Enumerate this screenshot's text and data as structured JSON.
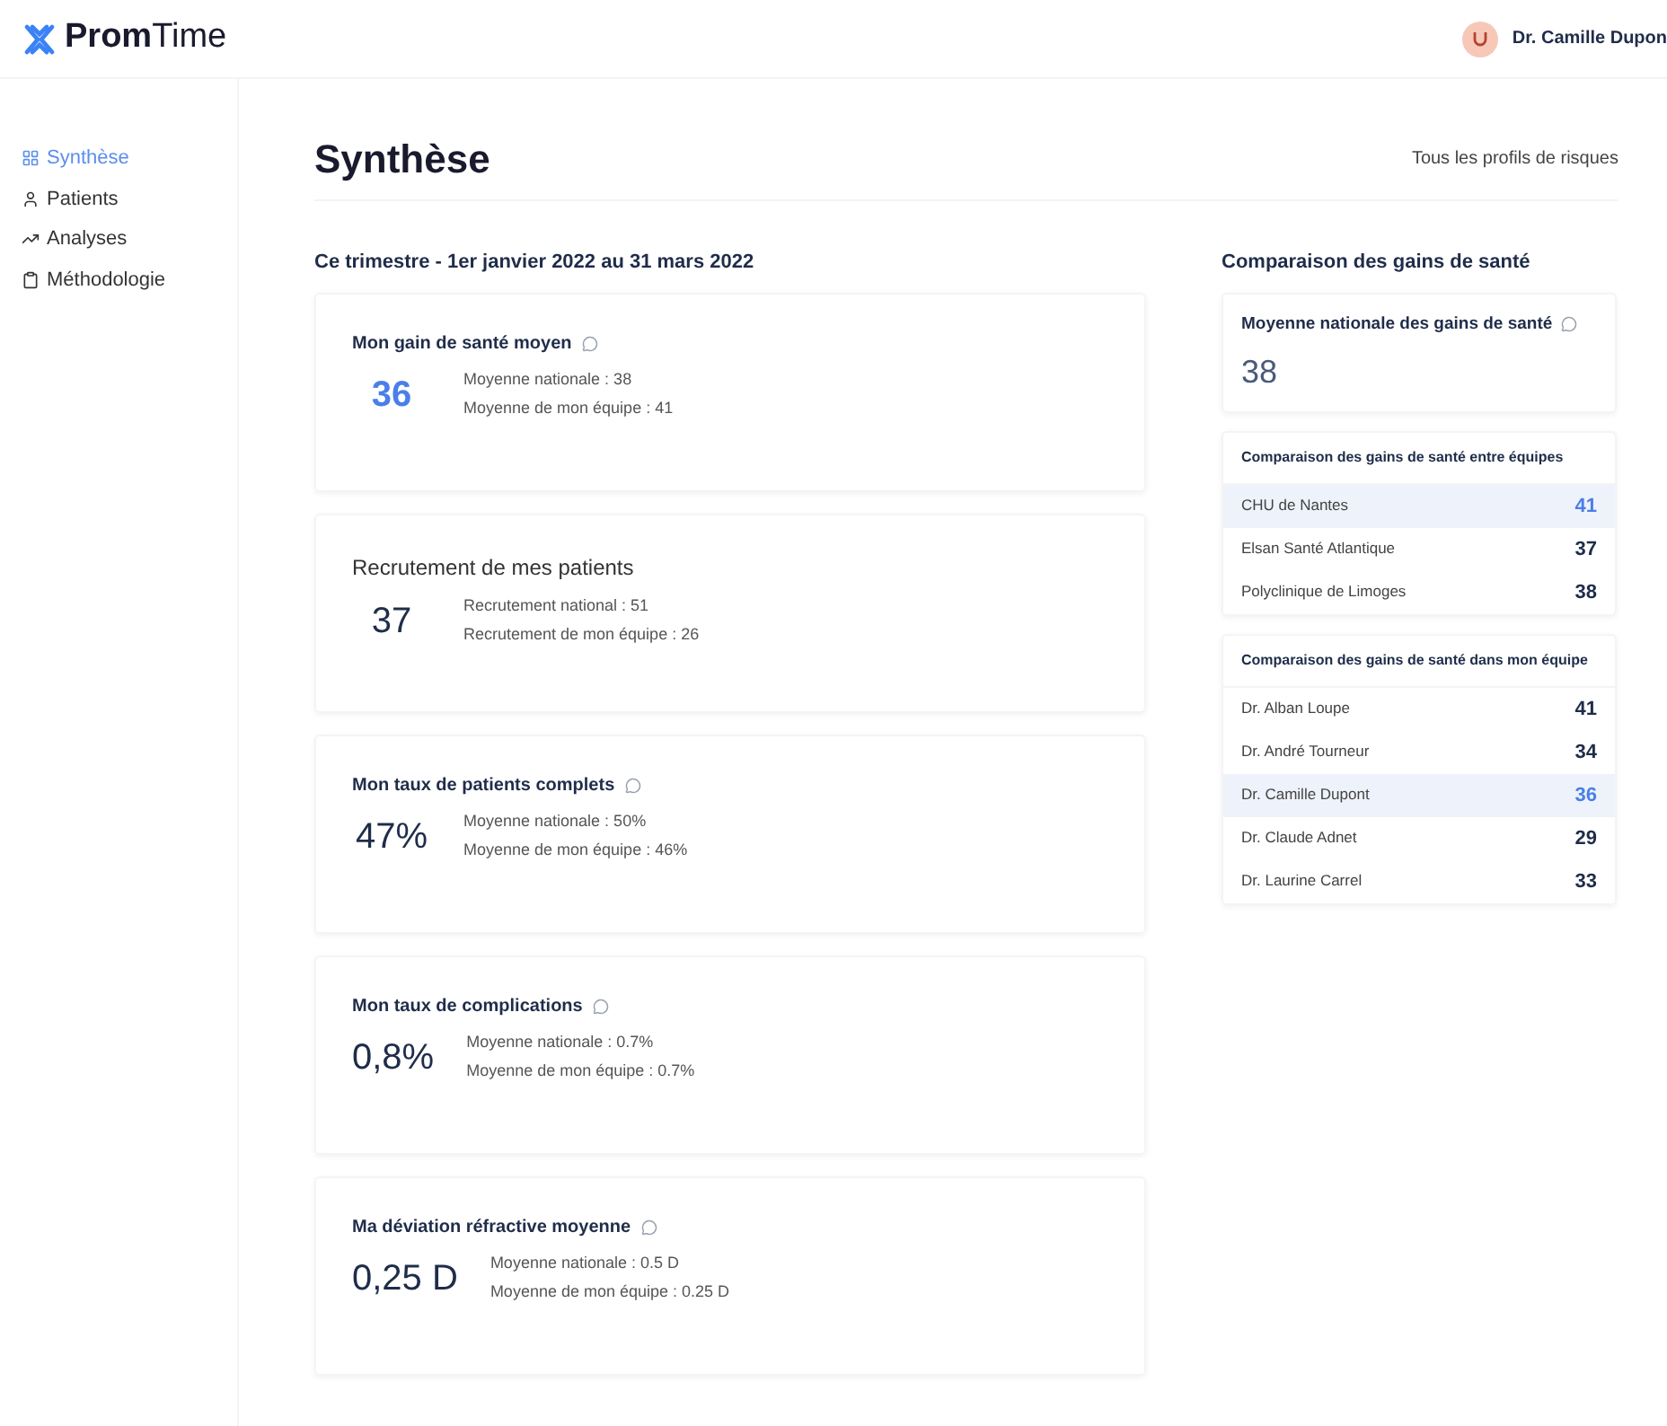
{
  "header": {
    "logo": "**Prom**Time",
    "user": "Dr. Camille Dupon"
  },
  "sidebar": {
    "items": [
      {
        "label": "Synthèse",
        "selected": true
      },
      {
        "label": "Patients",
        "selected": false
      },
      {
        "label": "Analyses",
        "selected": false
      },
      {
        "label": "Méthodologie",
        "selected": false
      }
    ]
  },
  "page": {
    "title": "Synthèse",
    "link": "Tous les profils de risques"
  },
  "period": "Ce trimestre - 1er janvier 2022 au 31 mars 2022",
  "metrics": [
    {
      "title": "Mon gain de santé moyen",
      "info_icon": true,
      "value": "36",
      "highlighted": true,
      "lines": [
        "Moyenne nationale : 38",
        "Moyenne de mon équipe : 41"
      ]
    },
    {
      "title": "Recrutement de mes patients",
      "info_icon": false,
      "value": "37",
      "highlighted": false,
      "lines": [
        "Recrutement national : 51",
        "Recrutement de mon équipe : 26"
      ]
    },
    {
      "title": "Mon taux de patients complets",
      "info_icon": true,
      "value": "47%",
      "highlighted": false,
      "lines": [
        "Moyenne nationale : 50%",
        "Moyenne de mon équipe : 46%"
      ]
    },
    {
      "title": "Mon taux de complications",
      "info_icon": true,
      "value": "0,8%",
      "highlighted": false,
      "lines": [
        "Moyenne nationale : 0.7%",
        "Moyenne de mon équipe : 0.7%"
      ]
    },
    {
      "title": "Ma déviation réfractive moyenne",
      "info_icon": true,
      "value": "0,25 D",
      "highlighted": false,
      "lines": [
        "Moyenne nationale : 0.5 D",
        "Moyenne de mon équipe : 0.25 D"
      ]
    }
  ],
  "comparison": {
    "title": "Comparaison des gains de santé",
    "national": {
      "title": "Moyenne nationale des gains de santé",
      "value": "38"
    },
    "tables": [
      {
        "title": "Comparaison des gains de santé entre équipes",
        "rows": [
          {
            "name": "CHU de Nantes",
            "value": "41",
            "selected": true
          },
          {
            "name": "Elsan Santé Atlantique",
            "value": "37",
            "selected": false
          },
          {
            "name": "Polyclinique de Limoges",
            "value": "38",
            "selected": false
          }
        ]
      },
      {
        "title": "Comparaison des gains de santé dans mon équipe",
        "rows": [
          {
            "name": "Dr. Alban Loupe",
            "value": "41",
            "selected": false
          },
          {
            "name": "Dr. André Tourneur",
            "value": "34",
            "selected": false
          },
          {
            "name": "Dr. Camille Dupont",
            "value": "36",
            "selected": true
          },
          {
            "name": "Dr. Claude Adnet",
            "value": "29",
            "selected": false
          },
          {
            "name": "Dr. Laurine Carrel",
            "value": "33",
            "selected": false
          }
        ]
      }
    ]
  }
}
